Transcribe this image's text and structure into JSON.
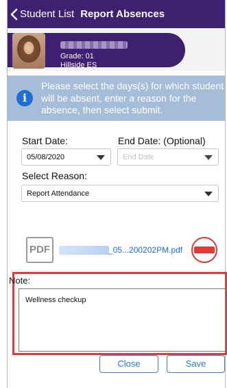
{
  "nav": {
    "back_label": "Student List",
    "title": "Report Absences"
  },
  "student": {
    "grade": "Grade: 01",
    "school": "Hillside ES"
  },
  "info": {
    "text": "Please select the days(s) for which student will be absent, enter a reason for the absence, then select submit."
  },
  "form": {
    "start_date_label": "Start Date:",
    "start_date_value": "05/08/2020",
    "end_date_label": "End Date: (Optional)",
    "end_date_placeholder": "End Date",
    "reason_label": "Select Reason:",
    "reason_value": "Report Attendance"
  },
  "attachment": {
    "icon_label": "PDF",
    "file_name": "_05...200202PM.pdf"
  },
  "note": {
    "label": "Note:",
    "value": "Wellness checkup"
  },
  "buttons": {
    "close": "Close",
    "save": "Save"
  },
  "colors": {
    "header": "#3e1f70",
    "info_bg": "#a6bdd9",
    "info_icon": "#1f6fd1",
    "link": "#1a6fe0",
    "remove": "#e23b35",
    "highlight": "#e23b3b"
  },
  "icons": {
    "back": "chevron-left-icon",
    "info": "info-icon",
    "file": "pdf-icon",
    "remove": "minus-circle-icon",
    "dropdown": "caret-down-icon"
  }
}
